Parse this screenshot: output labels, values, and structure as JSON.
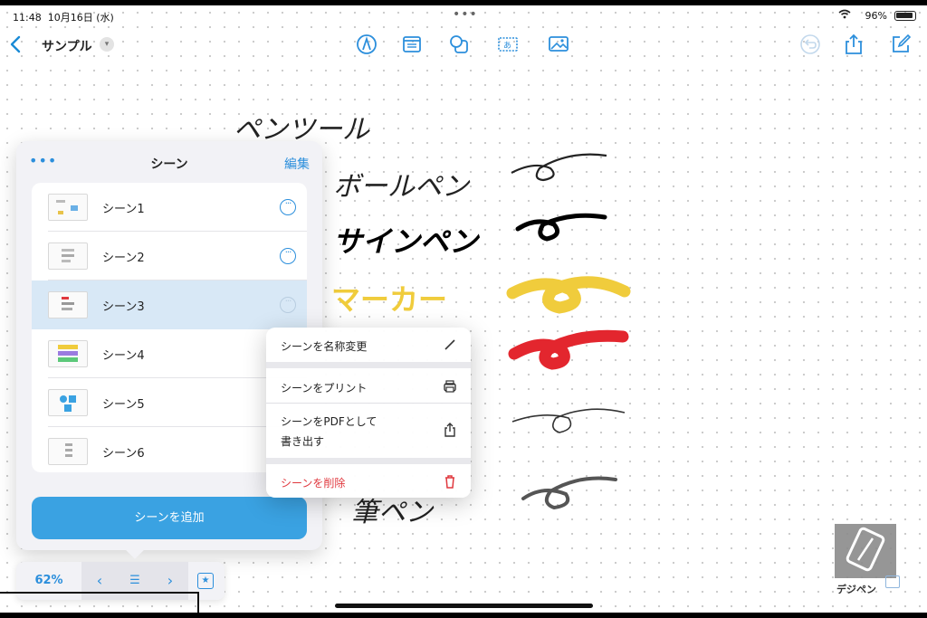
{
  "status_bar": {
    "time": "11:48",
    "date": "10月16日 (水)",
    "dots": "•••",
    "battery_pct": "96%"
  },
  "toolbar": {
    "doc_title": "サンプル",
    "icons": [
      "back-chevron-icon",
      "pen-tool-icon",
      "sticky-note-icon",
      "shapes-icon",
      "text-box-icon",
      "media-icon",
      "undo-icon",
      "share-icon",
      "compose-icon"
    ]
  },
  "handwriting": {
    "heading": "ペンツール",
    "rows": [
      "ボールペン",
      "サインペン",
      "マーカー",
      "筆ペン"
    ]
  },
  "scenes_panel": {
    "more": "•••",
    "title": "シーン",
    "edit": "編集",
    "scenes": [
      {
        "name": "シーン1",
        "selected": false
      },
      {
        "name": "シーン2",
        "selected": false
      },
      {
        "name": "シーン3",
        "selected": true
      },
      {
        "name": "シーン4",
        "selected": false
      },
      {
        "name": "シーン5",
        "selected": false
      },
      {
        "name": "シーン6",
        "selected": false
      }
    ],
    "add_button": "シーンを追加"
  },
  "context_menu": {
    "rename": "シーンを名称変更",
    "print": "シーンをプリント",
    "export_line1": "シーンをPDFとして",
    "export_line2": "書き出す",
    "delete": "シーンを削除"
  },
  "bottom_nav": {
    "zoom": "62%",
    "prev": "‹",
    "list": "☰",
    "next": "›",
    "star": "★"
  },
  "watermark": {
    "text": "デジペン"
  },
  "colors": {
    "accent": "#2c8fdc",
    "add_button": "#3aa2e2",
    "selected_row": "#d8e8f6",
    "danger": "#e0383e",
    "marker_yellow": "#f0cc3c",
    "marker_red": "#e3262e"
  }
}
